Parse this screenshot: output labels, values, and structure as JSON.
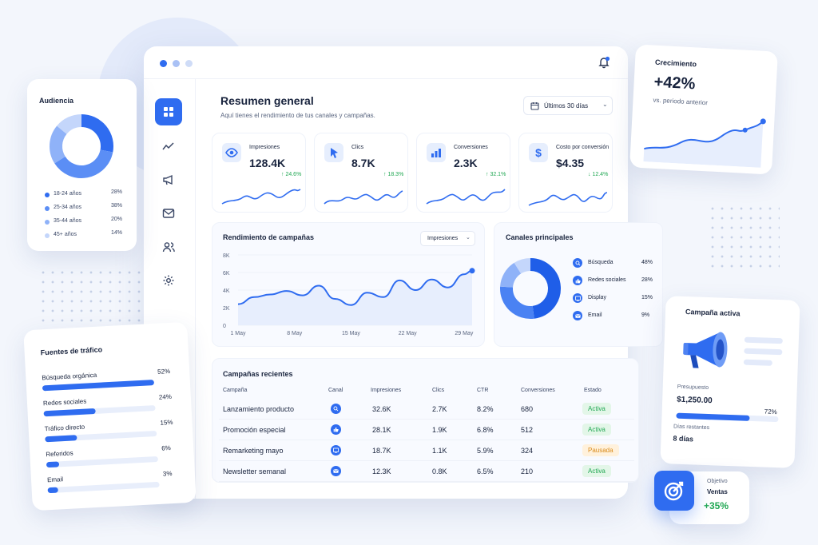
{
  "window": {
    "bell_icon": "bell-icon"
  },
  "header": {
    "title": "Resumen general",
    "subtitle": "Aquí tienes el rendimiento de tus canales y campañas.",
    "date_range": "Últimos 30 días"
  },
  "sidebar": [
    "grid-icon",
    "trend-icon",
    "megaphone-icon",
    "mail-icon",
    "users-icon",
    "gear-icon"
  ],
  "kpis": [
    {
      "label": "Impresiones",
      "value": "128.4K",
      "delta": "↑ 24.6%",
      "icon": "eye-icon",
      "up": true
    },
    {
      "label": "Clics",
      "value": "8.7K",
      "delta": "↑ 18.3%",
      "icon": "cursor-icon",
      "up": true
    },
    {
      "label": "Conversiones",
      "value": "2.3K",
      "delta": "↑ 32.1%",
      "icon": "bar-chart-icon",
      "up": true
    },
    {
      "label": "Costo por conversión",
      "value": "$4.35",
      "delta": "↓ 12.4%",
      "icon": "dollar-icon",
      "up": false
    }
  ],
  "performance": {
    "title": "Rendimiento de campañas",
    "metric": "Impresiones"
  },
  "chart_data": {
    "type": "line",
    "title": "Rendimiento de campañas",
    "categories": [
      "1 May",
      "8 May",
      "15 May",
      "22 May",
      "29 May"
    ],
    "ylabels": [
      "0",
      "2K",
      "4K",
      "6K",
      "8K"
    ],
    "ylim": [
      0,
      8000
    ],
    "x": [
      0,
      2,
      4,
      6,
      8,
      10,
      12,
      14,
      16,
      18,
      20,
      22,
      24,
      26,
      28,
      29
    ],
    "values": [
      2400,
      3200,
      3500,
      3900,
      3400,
      4500,
      3000,
      2300,
      3700,
      3200,
      5100,
      4000,
      5200,
      4300,
      5800,
      6200
    ]
  },
  "channels": {
    "title": "Canales principales",
    "items": [
      {
        "label": "Búsqueda",
        "pct": "48%",
        "value": 48,
        "color": "#1f5ee8"
      },
      {
        "label": "Redes sociales",
        "pct": "28%",
        "value": 28,
        "color": "#4a82f3"
      },
      {
        "label": "Display",
        "pct": "15%",
        "value": 15,
        "color": "#8fb2f8"
      },
      {
        "label": "Email",
        "pct": "9%",
        "value": 9,
        "color": "#c4d6fb"
      }
    ]
  },
  "campaigns": {
    "title": "Campañas recientes",
    "headers": [
      "Campaña",
      "Canal",
      "Impresiones",
      "Clics",
      "CTR",
      "Conversiones",
      "Estado"
    ],
    "rows": [
      {
        "name": "Lanzamiento producto",
        "imp": "32.6K",
        "clicks": "2.7K",
        "ctr": "8.2%",
        "conv": "680",
        "status": "Activa",
        "icon": "search-icon"
      },
      {
        "name": "Promoción especial",
        "imp": "28.1K",
        "clicks": "1.9K",
        "ctr": "6.8%",
        "conv": "512",
        "status": "Activa",
        "icon": "thumbs-up-icon"
      },
      {
        "name": "Remarketing mayo",
        "imp": "18.7K",
        "clicks": "1.1K",
        "ctr": "5.9%",
        "conv": "324",
        "status": "Pausada",
        "icon": "display-icon"
      },
      {
        "name": "Newsletter semanal",
        "imp": "12.3K",
        "clicks": "0.8K",
        "ctr": "6.5%",
        "conv": "210",
        "status": "Activa",
        "icon": "mail-icon"
      }
    ]
  },
  "audience": {
    "title": "Audiencia",
    "items": [
      {
        "label": "18-24 años",
        "pct": "28%",
        "value": 28,
        "color": "#2f6cf0"
      },
      {
        "label": "25-34 años",
        "pct": "38%",
        "value": 38,
        "color": "#5b8ef5"
      },
      {
        "label": "35-44 años",
        "pct": "20%",
        "value": 20,
        "color": "#8fb2f8"
      },
      {
        "label": "45+ años",
        "pct": "14%",
        "value": 14,
        "color": "#c4d6fb"
      }
    ]
  },
  "traffic": {
    "title": "Fuentes de tráfico",
    "items": [
      {
        "label": "Búsqueda orgánica",
        "pct": "52%",
        "value": 52
      },
      {
        "label": "Redes sociales",
        "pct": "24%",
        "value": 24
      },
      {
        "label": "Tráfico directo",
        "pct": "15%",
        "value": 15
      },
      {
        "label": "Referidos",
        "pct": "6%",
        "value": 6
      },
      {
        "label": "Email",
        "pct": "3%",
        "value": 3
      }
    ]
  },
  "growth": {
    "title": "Crecimiento",
    "value": "+42%",
    "caption": "vs. periodo anterior"
  },
  "active": {
    "title": "Campaña activa",
    "budget_label": "Presupuesto",
    "budget": "$1,250.00",
    "budget_pct": "72%",
    "budget_value": 72,
    "days_label": "Días restantes",
    "days": "8 días"
  },
  "goal": {
    "label": "Objetivo",
    "name": "Ventas",
    "value": "+35%"
  }
}
